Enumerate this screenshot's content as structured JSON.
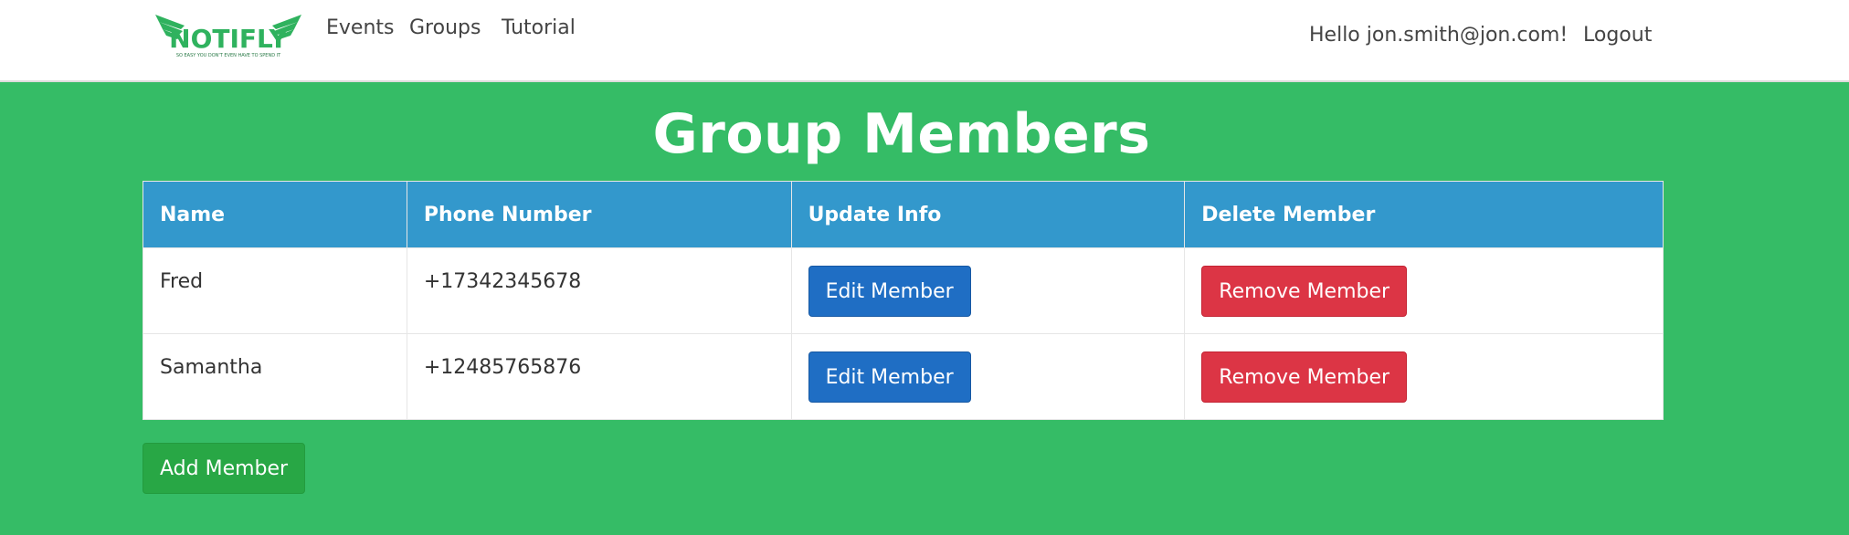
{
  "nav": {
    "logo_text": "NOTIFLY",
    "logo_tagline": "SO EASY YOU DON'T EVEN HAVE TO SPEND IT",
    "links": [
      "Events",
      "Groups",
      "Tutorial"
    ],
    "greeting": "Hello jon.smith@jon.com!",
    "logout": "Logout"
  },
  "page": {
    "title": "Group Members"
  },
  "table": {
    "headers": [
      "Name",
      "Phone Number",
      "Update Info",
      "Delete Member"
    ],
    "rows": [
      {
        "name": "Fred",
        "phone": "+17342345678",
        "edit_label": "Edit Member",
        "remove_label": "Remove Member"
      },
      {
        "name": "Samantha",
        "phone": "+12485765876",
        "edit_label": "Edit Member",
        "remove_label": "Remove Member"
      }
    ]
  },
  "actions": {
    "add_member": "Add Member"
  },
  "colors": {
    "page_bg": "#35bc66",
    "header_bg": "#3398cc",
    "edit_btn": "#1f6ec4",
    "remove_btn": "#dc3545",
    "add_btn": "#28a745",
    "logo_green": "#2fb25e"
  }
}
